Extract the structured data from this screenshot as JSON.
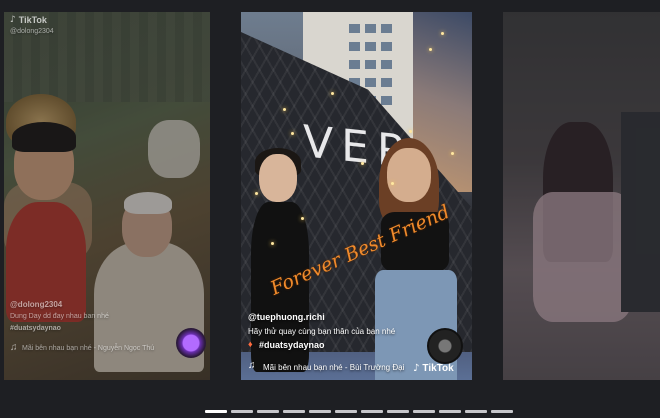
{
  "cards": {
    "left": {
      "logo": "TikTok",
      "watermark_user": "@dolong2304",
      "username": "@dolong2304",
      "caption_line1": "Dung Day dd đay nhau ban nhé",
      "caption_line2": "#duatsydaynao",
      "music": "Mãi bên nhau bạn nhé - Nguyễn Ngọc Thú"
    },
    "center": {
      "sign_text": "VER",
      "overlay_title": "Forever Best Friend",
      "username": "@tuephuong.richi",
      "caption": "Hãy thử quay cùng bạn thân của bạn nhé",
      "hashtag": "#duatsydaynao",
      "music": "Mãi bên nhau bạn nhé - Bùi Trường Đại",
      "logo": "TikTok"
    }
  },
  "icons": {
    "tiktok": "tiktok-icon",
    "music": "music-note-icon",
    "flame": "flame-icon",
    "disc": "music-disc-icon"
  },
  "progress": {
    "segments": 12,
    "active_index": 0
  },
  "colors": {
    "background": "#1e1f23",
    "overlay_title": "#f08a2c",
    "text": "#ffffff"
  }
}
